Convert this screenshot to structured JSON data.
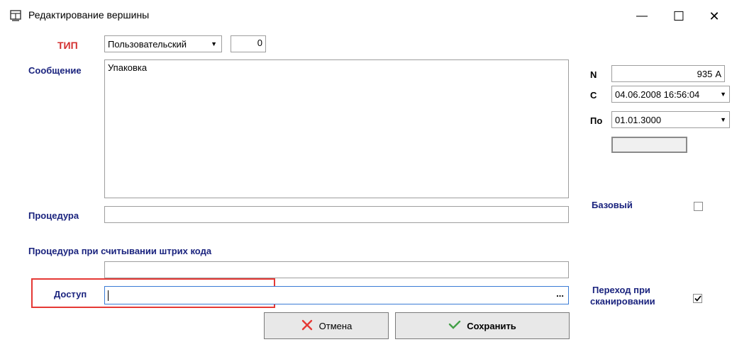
{
  "window": {
    "title": "Редактирование вершины",
    "minimize_glyph": "—",
    "maximize_glyph": "☐",
    "close_glyph": "✕"
  },
  "form": {
    "type_label": "ТИП",
    "type_value": "Пользовательский",
    "type_number": "0",
    "message_label": "Сообщение",
    "message_value": "Упаковка",
    "procedure_label": "Процедура",
    "procedure_value": "",
    "barcode_procedure_label": "Процедура при считывании штрих кода",
    "barcode_procedure_value": "",
    "access_label": "Доступ",
    "access_value": "",
    "access_browse": "..."
  },
  "side": {
    "n_label": "N",
    "n_value": "935",
    "n_suffix": "A",
    "from_label": "С",
    "from_value": "04.06.2008 16:56:04",
    "to_label": "По",
    "to_value": "01.01.3000",
    "base_label": "Базовый",
    "base_checked": false,
    "transition_label_1": "Переход при",
    "transition_label_2": "сканировании",
    "transition_checked": true
  },
  "buttons": {
    "cancel": "Отмена",
    "save": "Сохранить"
  },
  "colors": {
    "label_blue": "#1a237e",
    "label_red": "#d32f2f",
    "highlight_red": "#e53935",
    "access_focus": "#3a7bd5"
  }
}
